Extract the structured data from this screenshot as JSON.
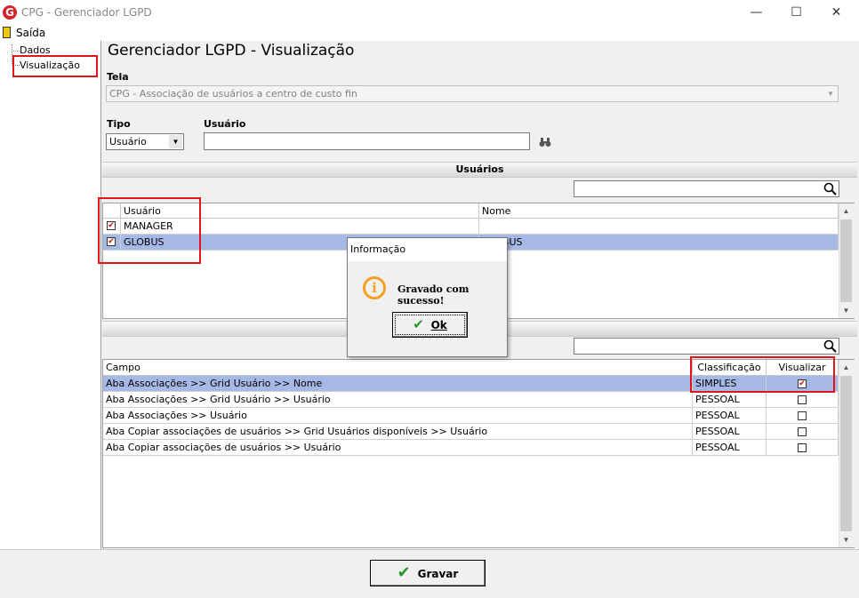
{
  "window": {
    "title": "CPG - Gerenciador LGPD",
    "logo": "G",
    "minimize": "—",
    "maximize": "☐",
    "close": "✕"
  },
  "menu": {
    "exit_label": "Saída"
  },
  "tree": {
    "items": [
      {
        "label": "Dados"
      },
      {
        "label": "Visualização",
        "selected": true
      }
    ]
  },
  "page": {
    "title": "Gerenciador LGPD - Visualização"
  },
  "form": {
    "tela_label": "Tela",
    "tela_value": "CPG - Associação de usuários a centro de custo fin",
    "tipo_label": "Tipo",
    "tipo_value": "Usuário",
    "usuario_label": "Usuário",
    "usuario_value": ""
  },
  "users_section": {
    "title": "Usuários",
    "search_value": "",
    "columns": [
      "Usuário",
      "Nome"
    ],
    "rows": [
      {
        "usuario": "MANAGER",
        "nome": "",
        "checked": true
      },
      {
        "usuario": "GLOBUS",
        "nome": "GLOBUS",
        "checked": true,
        "selected": true
      }
    ]
  },
  "fields_section": {
    "title": "Campo",
    "search_value": "",
    "columns": [
      "Campo",
      "Classificação",
      "Visualizar"
    ],
    "rows": [
      {
        "campo": "Aba Associações >> Grid Usuário >> Nome",
        "classificacao": "SIMPLES",
        "visualizar": true,
        "selected": true
      },
      {
        "campo": "Aba Associações >> Grid Usuário >> Usuário",
        "classificacao": "PESSOAL",
        "visualizar": false
      },
      {
        "campo": "Aba Associações >> Usuário",
        "classificacao": "PESSOAL",
        "visualizar": false
      },
      {
        "campo": "Aba Copiar associações de usuários >> Grid Usuários disponíveis >> Usuário",
        "classificacao": "PESSOAL",
        "visualizar": false
      },
      {
        "campo": "Aba Copiar associações de usuários >> Usuário",
        "classificacao": "PESSOAL",
        "visualizar": false
      }
    ]
  },
  "dialog": {
    "title": "Informação",
    "message": "Gravado com sucesso!",
    "ok_label": "Ok"
  },
  "footer": {
    "save_label": "Gravar"
  },
  "colors": {
    "accent_red": "#e0141a",
    "selection": "#a6b9e6",
    "info_orange": "#f5a020",
    "check_green": "#2a9a2a"
  }
}
